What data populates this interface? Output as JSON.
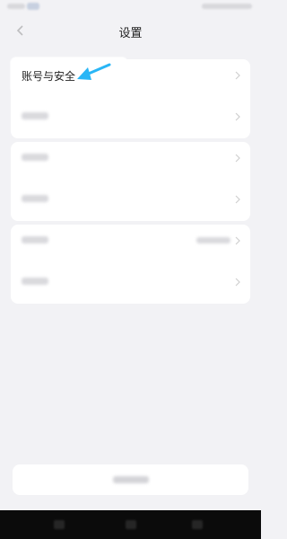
{
  "header": {
    "title": "设置",
    "back_icon": "chevron-left-icon"
  },
  "settings": {
    "account_security_label": "账号与安全"
  },
  "annotation": {
    "arrow_color": "#29b6f6"
  }
}
